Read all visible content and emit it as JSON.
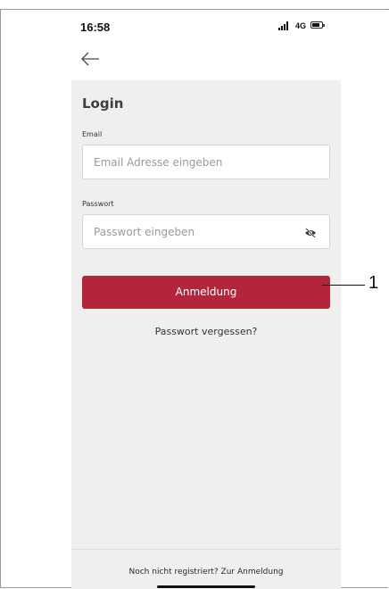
{
  "status_bar": {
    "time": "16:58",
    "network": "4G",
    "signal_icon": "signal-bars-icon",
    "battery_icon": "battery-icon"
  },
  "nav": {
    "back_icon": "arrow-left-icon"
  },
  "login": {
    "title": "Login",
    "email": {
      "label": "Email",
      "placeholder": "Email Adresse eingeben",
      "value": ""
    },
    "password": {
      "label": "Passwort",
      "placeholder": "Passwort eingeben",
      "value": "",
      "toggle_icon": "eye-off-icon"
    },
    "submit_label": "Anmeldung",
    "forgot_label": "Passwort vergessen?"
  },
  "footer": {
    "register_text": "Noch nicht registriert? Zur Anmeldung"
  },
  "annotation": {
    "callout_number": "1"
  },
  "colors": {
    "accent": "#b3253a",
    "content_bg": "#efefee"
  }
}
